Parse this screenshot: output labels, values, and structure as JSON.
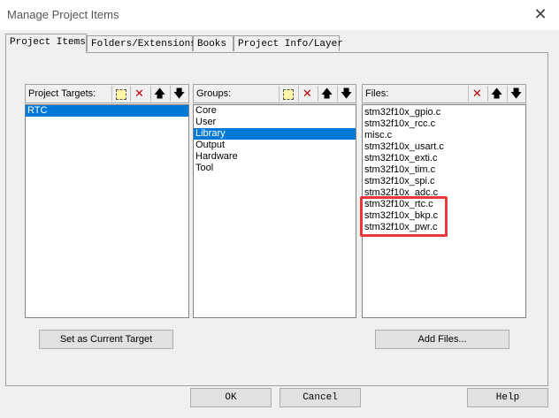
{
  "window": {
    "title": "Manage Project Items",
    "close_glyph": "✕"
  },
  "tabs": [
    "Project Items",
    "Folders/Extensions",
    "Books",
    "Project Info/Layer"
  ],
  "targets": {
    "label": "Project Targets:",
    "items": [
      "RTC"
    ],
    "selected": 0,
    "button": "Set as Current Target"
  },
  "groups": {
    "label": "Groups:",
    "items": [
      "Core",
      "User",
      "Library",
      "Output",
      "Hardware",
      "Tool"
    ],
    "selected": 2
  },
  "files": {
    "label": "Files:",
    "items": [
      "stm32f10x_gpio.c",
      "stm32f10x_rcc.c",
      "misc.c",
      "stm32f10x_usart.c",
      "stm32f10x_exti.c",
      "stm32f10x_tim.c",
      "stm32f10x_spi.c",
      "stm32f10x_adc.c",
      "stm32f10x_rtc.c",
      "stm32f10x_bkp.c",
      "stm32f10x_pwr.c"
    ],
    "button": "Add Files..."
  },
  "toolbar_icons": {
    "delete": "✕",
    "up": "🡅",
    "down": "🡇"
  },
  "buttons": {
    "ok": "OK",
    "cancel": "Cancel",
    "help": "Help"
  },
  "colors": {
    "selection": "#0078d7",
    "highlight": "#e8383d"
  }
}
